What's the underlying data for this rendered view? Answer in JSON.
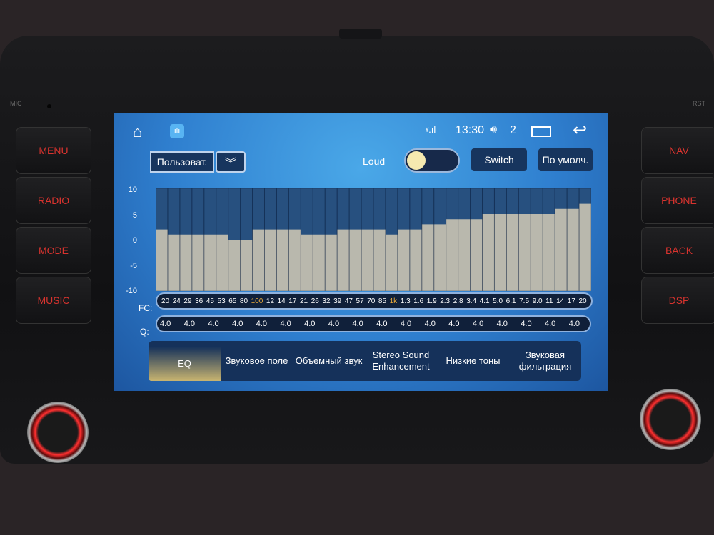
{
  "device": {
    "left_buttons": [
      "MENU",
      "RADIO",
      "MODE",
      "MUSIC"
    ],
    "right_buttons": [
      "NAV",
      "PHONE",
      "BACK",
      "DSP"
    ],
    "mic_label": "MIC",
    "rst_label": "RST"
  },
  "status_bar": {
    "time": "13:30",
    "volume": "2",
    "icons": [
      "home-icon",
      "equalizer-app-icon",
      "signal-icon",
      "volume-icon",
      "recent-apps-icon",
      "back-icon"
    ]
  },
  "controls": {
    "preset": "Пользоват.",
    "loud_label": "Loud",
    "loud_on": false,
    "switch_label": "Switch",
    "default_label": "По умолч."
  },
  "eq": {
    "y_ticks": [
      "10",
      "5",
      "0",
      "-5",
      "-10"
    ],
    "fc_label": "FC:",
    "q_label": "Q:",
    "fc": [
      "20",
      "24",
      "29",
      "36",
      "45",
      "53",
      "65",
      "80",
      "100",
      "12",
      "14",
      "17",
      "21",
      "26",
      "32",
      "39",
      "47",
      "57",
      "70",
      "85",
      "1k",
      "1.3",
      "1.6",
      "1.9",
      "2.3",
      "2.8",
      "3.4",
      "4.1",
      "5.0",
      "6.1",
      "7.5",
      "9.0",
      "11",
      "14",
      "17",
      "20"
    ],
    "highlighted_fc": [
      "100",
      "1k"
    ],
    "gains_db": [
      2,
      1,
      1,
      1,
      1,
      1,
      0,
      0,
      2,
      2,
      2,
      2,
      1,
      1,
      1,
      2,
      2,
      2,
      2,
      1,
      2,
      2,
      3,
      3,
      4,
      4,
      4,
      5,
      5,
      5,
      5,
      5,
      5,
      6,
      6,
      7
    ],
    "q": [
      "4.0",
      "4.0",
      "4.0",
      "4.0",
      "4.0",
      "4.0",
      "4.0",
      "4.0",
      "4.0",
      "4.0",
      "4.0",
      "4.0",
      "4.0",
      "4.0",
      "4.0",
      "4.0",
      "4.0",
      "4.0"
    ],
    "y_range": [
      -10,
      10
    ]
  },
  "tabs": [
    {
      "label": "EQ",
      "active": true
    },
    {
      "label": "Звуковое поле"
    },
    {
      "label": "Объемный звук"
    },
    {
      "label": "Stereo Sound Enhancement"
    },
    {
      "label": "Низкие тоны"
    },
    {
      "label": "Звуковая фильтрация"
    }
  ],
  "colors": {
    "accent": "#e8a93a",
    "button_red": "#d8332e",
    "fill": "#b9b8ad"
  }
}
